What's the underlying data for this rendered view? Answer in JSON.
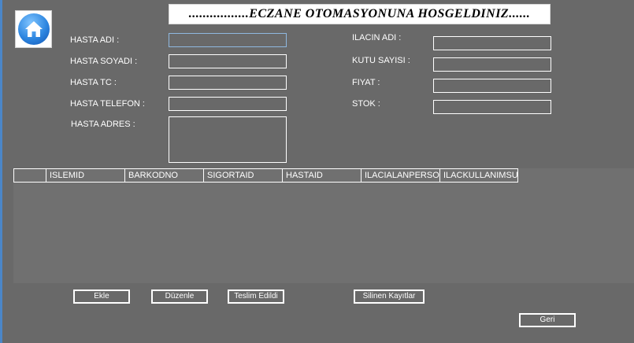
{
  "header": {
    "title": ".................ECZANE OTOMASYONUNA HOSGELDINIZ......",
    "home_icon": "home-icon"
  },
  "patient": {
    "name_label": "HASTA ADI :",
    "surname_label": "HASTA SOYADI :",
    "tc_label": "HASTA TC :",
    "phone_label": "HASTA TELEFON :",
    "address_label": "HASTA ADRES :",
    "name_value": "",
    "surname_value": "",
    "tc_value": "",
    "phone_value": "",
    "address_value": ""
  },
  "medicine": {
    "name_label": "ILACIN ADI :",
    "box_count_label": "KUTU SAYISI :",
    "price_label": "FIYAT :",
    "stock_label": "STOK :",
    "name_value": "",
    "box_count_value": "",
    "price_value": "",
    "stock_value": ""
  },
  "grid": {
    "columns": [
      "ISLEMID",
      "BARKODNO",
      "SIGORTAID",
      "HASTAID",
      "ILACIALANPERSO",
      "ILACKULLANIMSU"
    ],
    "rows": []
  },
  "buttons": {
    "add": "Ekle",
    "edit": "Düzenle",
    "delivered": "Teslim Edildi",
    "deleted_records": "Silinen Kayıtlar",
    "back": "Geri"
  },
  "colors": {
    "form_background": "#696969",
    "banner_background": "#ffffff",
    "text": "#ffffff"
  }
}
